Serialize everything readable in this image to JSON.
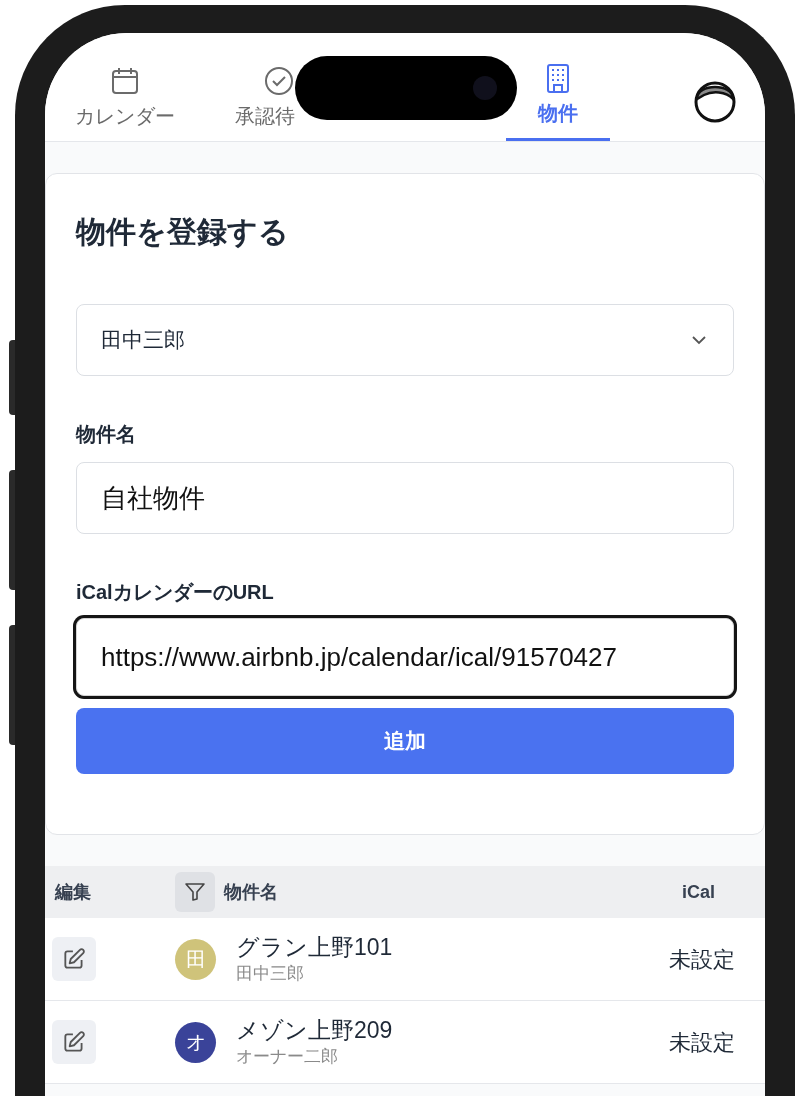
{
  "tabs": [
    {
      "kind": "calendar",
      "label": "カレンダー",
      "selected": false
    },
    {
      "kind": "check",
      "label": "承認待",
      "selected": false
    },
    {
      "kind": "building",
      "label": "物件",
      "selected": true
    }
  ],
  "form": {
    "title": "物件を登録する",
    "owner_select": {
      "value": "田中三郎"
    },
    "fields": [
      {
        "label": "物件名",
        "value": "自社物件",
        "focused": false
      },
      {
        "label": "iCalカレンダーのURL",
        "value": "https://www.airbnb.jp/calendar/ical/91570427",
        "focused": true
      }
    ],
    "submit_button": "追加"
  },
  "table": {
    "columns": [
      "編集",
      "物件名",
      "iCal"
    ],
    "rows": [
      {
        "initial": "田",
        "color": "#cfc37a",
        "name": "グラン上野101",
        "owner": "田中三郎",
        "ical": "未設定"
      },
      {
        "initial": "オ",
        "color": "#3a4399",
        "name": "メゾン上野209",
        "owner": "オーナー二郎",
        "ical": "未設定"
      }
    ]
  }
}
